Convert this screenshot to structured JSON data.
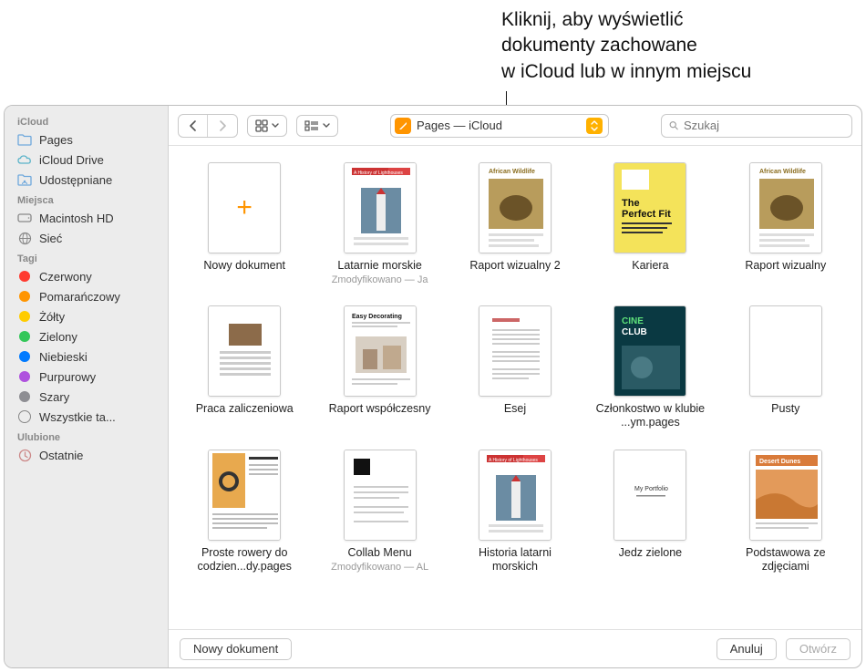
{
  "annotation": "Kliknij, aby wyświetlić\ndokumenty zachowane\nw iCloud lub w innym miejscu",
  "sidebar": {
    "sections": [
      {
        "title": "iCloud",
        "items": [
          {
            "icon": "folder-icon",
            "label": "Pages"
          },
          {
            "icon": "cloud-icon",
            "label": "iCloud Drive"
          },
          {
            "icon": "shared-folder-icon",
            "label": "Udostępniane"
          }
        ]
      },
      {
        "title": "Miejsca",
        "items": [
          {
            "icon": "disk-icon",
            "label": "Macintosh HD"
          },
          {
            "icon": "globe-icon",
            "label": "Sieć"
          }
        ]
      },
      {
        "title": "Tagi",
        "items": [
          {
            "color": "#ff3b30",
            "label": "Czerwony"
          },
          {
            "color": "#ff9500",
            "label": "Pomarańczowy"
          },
          {
            "color": "#ffcc00",
            "label": "Żółty"
          },
          {
            "color": "#34c759",
            "label": "Zielony"
          },
          {
            "color": "#007aff",
            "label": "Niebieski"
          },
          {
            "color": "#af52de",
            "label": "Purpurowy"
          },
          {
            "color": "#8e8e93",
            "label": "Szary"
          },
          {
            "icon": "all-tags-icon",
            "label": "Wszystkie ta..."
          }
        ]
      },
      {
        "title": "Ulubione",
        "items": [
          {
            "icon": "recent-icon",
            "label": "Ostatnie"
          }
        ]
      }
    ]
  },
  "toolbar": {
    "location_label": "Pages — iCloud"
  },
  "search": {
    "placeholder": "Szukaj"
  },
  "documents": [
    {
      "title": "Nowy dokument",
      "sub": "",
      "kind": "new"
    },
    {
      "title": "Latarnie morskie",
      "sub": "Zmodyfikowano — Ja",
      "kind": "lighthouse"
    },
    {
      "title": "Raport wizualny 2",
      "sub": "",
      "kind": "wildlife"
    },
    {
      "title": "Kariera",
      "sub": "",
      "kind": "career"
    },
    {
      "title": "Raport wizualny",
      "sub": "",
      "kind": "wildlife"
    },
    {
      "title": "Praca zaliczeniowa",
      "sub": "",
      "kind": "text1"
    },
    {
      "title": "Raport współczesny",
      "sub": "",
      "kind": "decor"
    },
    {
      "title": "Esej",
      "sub": "",
      "kind": "text2"
    },
    {
      "title": "Członkostwo w klubie ...ym.pages",
      "sub": "",
      "kind": "club"
    },
    {
      "title": "Pusty",
      "sub": "",
      "kind": "blank"
    },
    {
      "title": "Proste rowery do codzien...dy.pages",
      "sub": "",
      "kind": "bike"
    },
    {
      "title": "Collab Menu",
      "sub": "Zmodyfikowano — AL",
      "kind": "menu"
    },
    {
      "title": "Historia latarni morskich",
      "sub": "",
      "kind": "lighthouse"
    },
    {
      "title": "Jedz zielone",
      "sub": "",
      "kind": "portfolio"
    },
    {
      "title": "Podstawowa ze zdjęciami",
      "sub": "",
      "kind": "desert"
    }
  ],
  "footer": {
    "new_doc": "Nowy dokument",
    "cancel": "Anuluj",
    "open": "Otwórz"
  }
}
